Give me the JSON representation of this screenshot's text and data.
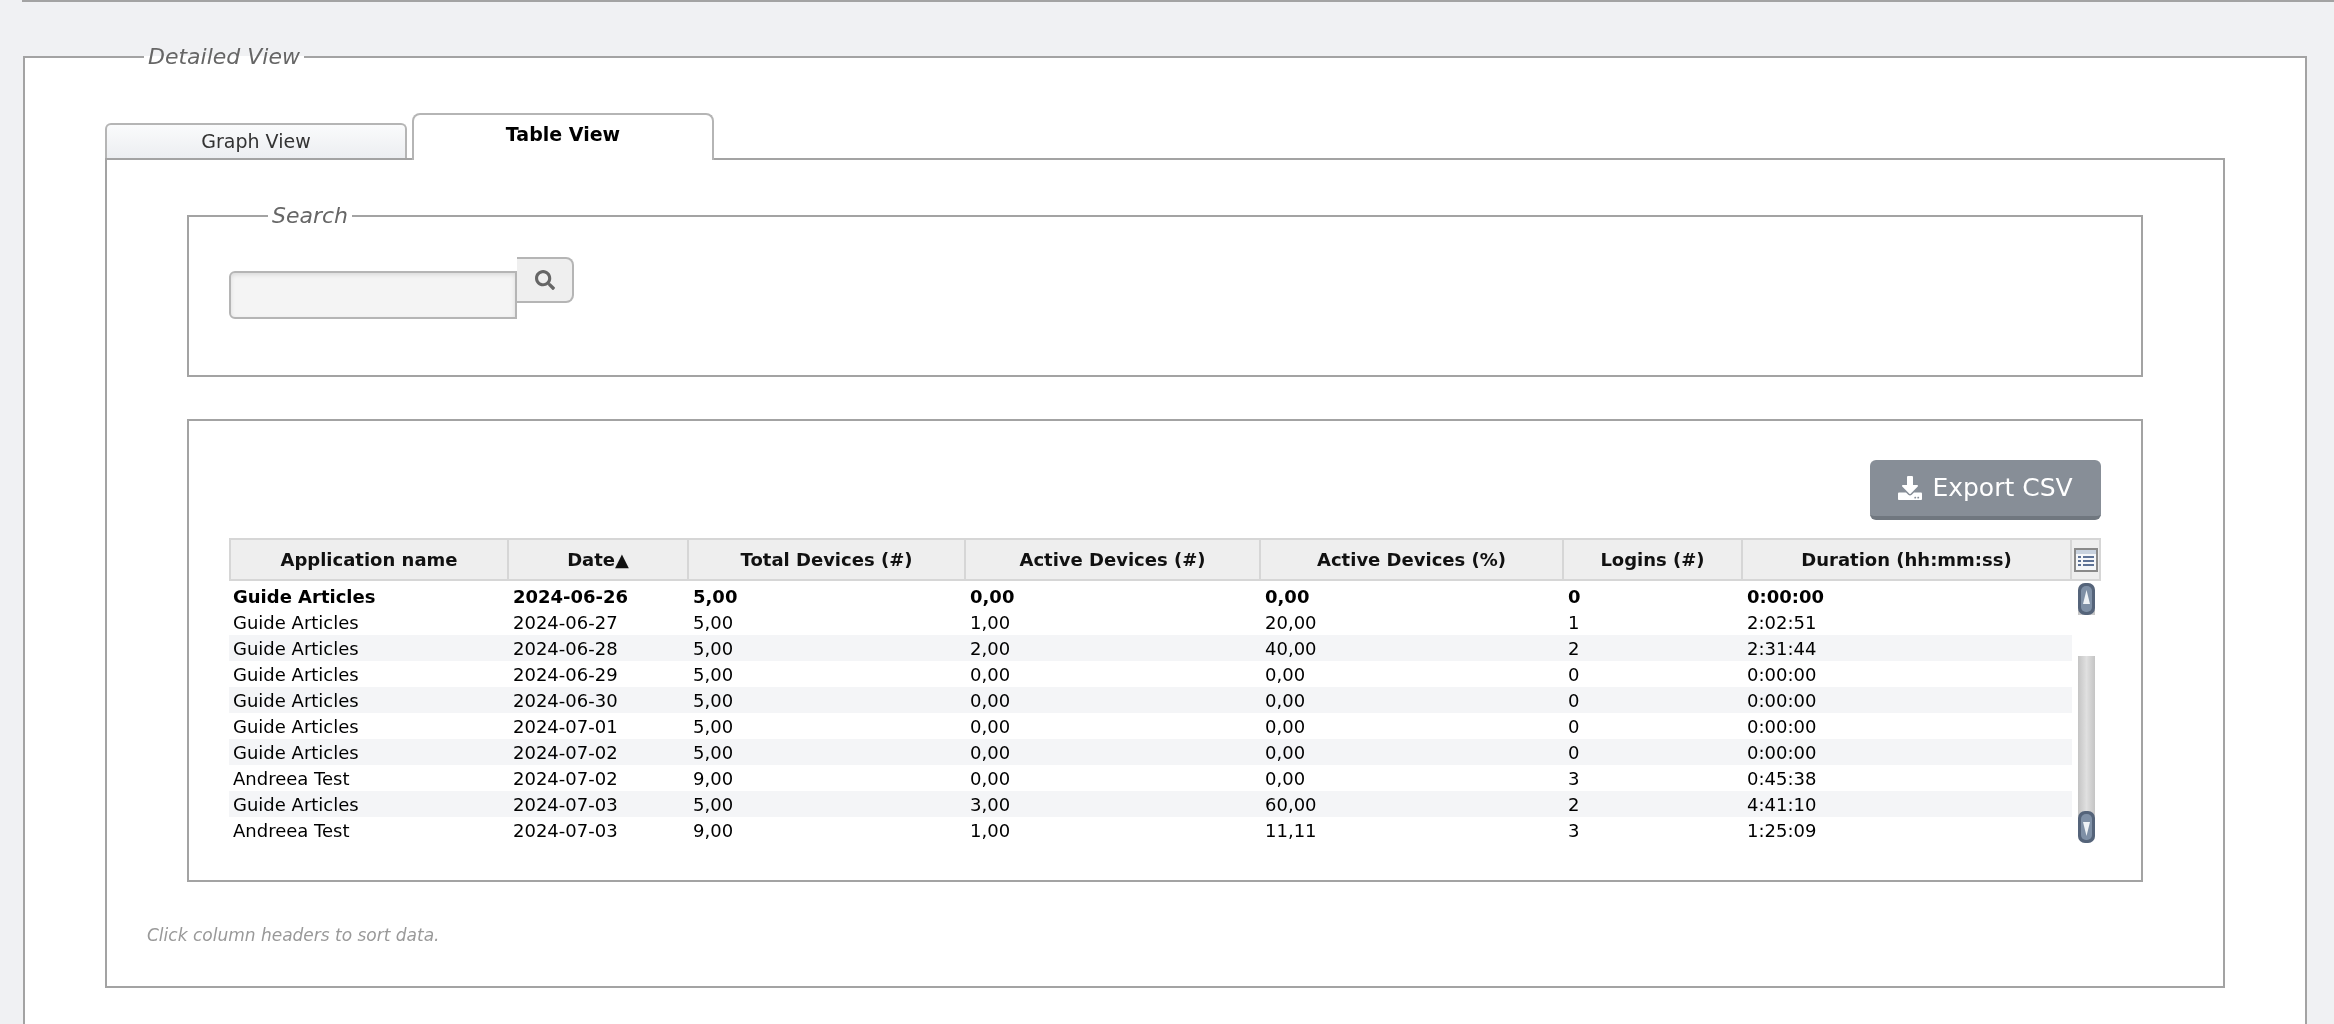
{
  "detailed_view": {
    "title": "Detailed View"
  },
  "tabs": [
    {
      "label": "Graph View",
      "selected": false
    },
    {
      "label": "Table View",
      "selected": true
    }
  ],
  "search": {
    "title": "Search"
  },
  "export_button": {
    "label": "Export CSV"
  },
  "table": {
    "columns": [
      "Application name",
      "Date▲",
      "Total Devices (#)",
      "Active Devices (#)",
      "Active Devices (%)",
      "Logins (#)",
      "Duration (hh:mm:ss)"
    ],
    "rows": [
      {
        "selected": true,
        "cells": [
          "Guide Articles",
          "2024-06-26",
          "5,00",
          "0,00",
          "0,00",
          "0",
          "0:00:00"
        ]
      },
      {
        "selected": false,
        "cells": [
          "Guide Articles",
          "2024-06-27",
          "5,00",
          "1,00",
          "20,00",
          "1",
          "2:02:51"
        ]
      },
      {
        "selected": false,
        "cells": [
          "Guide Articles",
          "2024-06-28",
          "5,00",
          "2,00",
          "40,00",
          "2",
          "2:31:44"
        ]
      },
      {
        "selected": false,
        "cells": [
          "Guide Articles",
          "2024-06-29",
          "5,00",
          "0,00",
          "0,00",
          "0",
          "0:00:00"
        ]
      },
      {
        "selected": false,
        "cells": [
          "Guide Articles",
          "2024-06-30",
          "5,00",
          "0,00",
          "0,00",
          "0",
          "0:00:00"
        ]
      },
      {
        "selected": false,
        "cells": [
          "Guide Articles",
          "2024-07-01",
          "5,00",
          "0,00",
          "0,00",
          "0",
          "0:00:00"
        ]
      },
      {
        "selected": false,
        "cells": [
          "Guide Articles",
          "2024-07-02",
          "5,00",
          "0,00",
          "0,00",
          "0",
          "0:00:00"
        ]
      },
      {
        "selected": false,
        "cells": [
          "Andreea Test",
          "2024-07-02",
          "9,00",
          "0,00",
          "0,00",
          "3",
          "0:45:38"
        ]
      },
      {
        "selected": false,
        "cells": [
          "Guide Articles",
          "2024-07-03",
          "5,00",
          "3,00",
          "60,00",
          "2",
          "4:41:10"
        ]
      },
      {
        "selected": false,
        "cells": [
          "Andreea Test",
          "2024-07-03",
          "9,00",
          "1,00",
          "11,11",
          "3",
          "1:25:09"
        ]
      }
    ]
  },
  "footer_note": "Click column headers to sort data."
}
